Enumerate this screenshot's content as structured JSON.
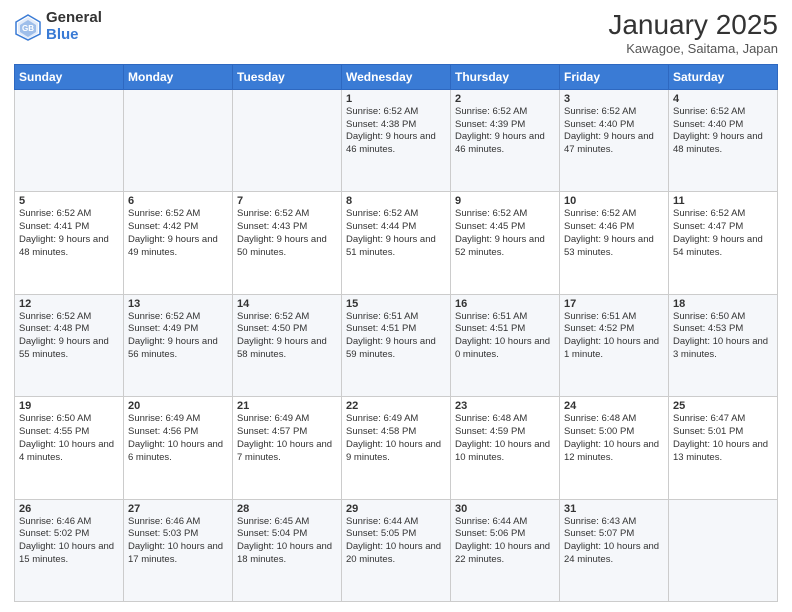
{
  "header": {
    "logo_general": "General",
    "logo_blue": "Blue",
    "month_title": "January 2025",
    "location": "Kawagoe, Saitama, Japan"
  },
  "days_of_week": [
    "Sunday",
    "Monday",
    "Tuesday",
    "Wednesday",
    "Thursday",
    "Friday",
    "Saturday"
  ],
  "weeks": [
    [
      {
        "day": "",
        "text": ""
      },
      {
        "day": "",
        "text": ""
      },
      {
        "day": "",
        "text": ""
      },
      {
        "day": "1",
        "text": "Sunrise: 6:52 AM\nSunset: 4:38 PM\nDaylight: 9 hours and 46 minutes."
      },
      {
        "day": "2",
        "text": "Sunrise: 6:52 AM\nSunset: 4:39 PM\nDaylight: 9 hours and 46 minutes."
      },
      {
        "day": "3",
        "text": "Sunrise: 6:52 AM\nSunset: 4:40 PM\nDaylight: 9 hours and 47 minutes."
      },
      {
        "day": "4",
        "text": "Sunrise: 6:52 AM\nSunset: 4:40 PM\nDaylight: 9 hours and 48 minutes."
      }
    ],
    [
      {
        "day": "5",
        "text": "Sunrise: 6:52 AM\nSunset: 4:41 PM\nDaylight: 9 hours and 48 minutes."
      },
      {
        "day": "6",
        "text": "Sunrise: 6:52 AM\nSunset: 4:42 PM\nDaylight: 9 hours and 49 minutes."
      },
      {
        "day": "7",
        "text": "Sunrise: 6:52 AM\nSunset: 4:43 PM\nDaylight: 9 hours and 50 minutes."
      },
      {
        "day": "8",
        "text": "Sunrise: 6:52 AM\nSunset: 4:44 PM\nDaylight: 9 hours and 51 minutes."
      },
      {
        "day": "9",
        "text": "Sunrise: 6:52 AM\nSunset: 4:45 PM\nDaylight: 9 hours and 52 minutes."
      },
      {
        "day": "10",
        "text": "Sunrise: 6:52 AM\nSunset: 4:46 PM\nDaylight: 9 hours and 53 minutes."
      },
      {
        "day": "11",
        "text": "Sunrise: 6:52 AM\nSunset: 4:47 PM\nDaylight: 9 hours and 54 minutes."
      }
    ],
    [
      {
        "day": "12",
        "text": "Sunrise: 6:52 AM\nSunset: 4:48 PM\nDaylight: 9 hours and 55 minutes."
      },
      {
        "day": "13",
        "text": "Sunrise: 6:52 AM\nSunset: 4:49 PM\nDaylight: 9 hours and 56 minutes."
      },
      {
        "day": "14",
        "text": "Sunrise: 6:52 AM\nSunset: 4:50 PM\nDaylight: 9 hours and 58 minutes."
      },
      {
        "day": "15",
        "text": "Sunrise: 6:51 AM\nSunset: 4:51 PM\nDaylight: 9 hours and 59 minutes."
      },
      {
        "day": "16",
        "text": "Sunrise: 6:51 AM\nSunset: 4:51 PM\nDaylight: 10 hours and 0 minutes."
      },
      {
        "day": "17",
        "text": "Sunrise: 6:51 AM\nSunset: 4:52 PM\nDaylight: 10 hours and 1 minute."
      },
      {
        "day": "18",
        "text": "Sunrise: 6:50 AM\nSunset: 4:53 PM\nDaylight: 10 hours and 3 minutes."
      }
    ],
    [
      {
        "day": "19",
        "text": "Sunrise: 6:50 AM\nSunset: 4:55 PM\nDaylight: 10 hours and 4 minutes."
      },
      {
        "day": "20",
        "text": "Sunrise: 6:49 AM\nSunset: 4:56 PM\nDaylight: 10 hours and 6 minutes."
      },
      {
        "day": "21",
        "text": "Sunrise: 6:49 AM\nSunset: 4:57 PM\nDaylight: 10 hours and 7 minutes."
      },
      {
        "day": "22",
        "text": "Sunrise: 6:49 AM\nSunset: 4:58 PM\nDaylight: 10 hours and 9 minutes."
      },
      {
        "day": "23",
        "text": "Sunrise: 6:48 AM\nSunset: 4:59 PM\nDaylight: 10 hours and 10 minutes."
      },
      {
        "day": "24",
        "text": "Sunrise: 6:48 AM\nSunset: 5:00 PM\nDaylight: 10 hours and 12 minutes."
      },
      {
        "day": "25",
        "text": "Sunrise: 6:47 AM\nSunset: 5:01 PM\nDaylight: 10 hours and 13 minutes."
      }
    ],
    [
      {
        "day": "26",
        "text": "Sunrise: 6:46 AM\nSunset: 5:02 PM\nDaylight: 10 hours and 15 minutes."
      },
      {
        "day": "27",
        "text": "Sunrise: 6:46 AM\nSunset: 5:03 PM\nDaylight: 10 hours and 17 minutes."
      },
      {
        "day": "28",
        "text": "Sunrise: 6:45 AM\nSunset: 5:04 PM\nDaylight: 10 hours and 18 minutes."
      },
      {
        "day": "29",
        "text": "Sunrise: 6:44 AM\nSunset: 5:05 PM\nDaylight: 10 hours and 20 minutes."
      },
      {
        "day": "30",
        "text": "Sunrise: 6:44 AM\nSunset: 5:06 PM\nDaylight: 10 hours and 22 minutes."
      },
      {
        "day": "31",
        "text": "Sunrise: 6:43 AM\nSunset: 5:07 PM\nDaylight: 10 hours and 24 minutes."
      },
      {
        "day": "",
        "text": ""
      }
    ]
  ]
}
